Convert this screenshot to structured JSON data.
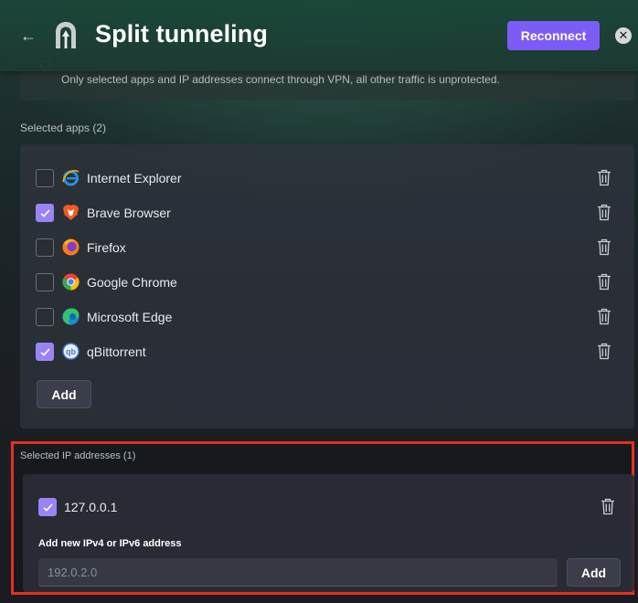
{
  "header": {
    "title": "Split tunneling",
    "reconnect_label": "Reconnect",
    "back_icon": "arrow-left-icon",
    "close_icon": "close-icon"
  },
  "mode": {
    "description": "Only selected apps and IP addresses connect through VPN, all other traffic is unprotected."
  },
  "apps": {
    "label": "Selected apps (2)",
    "items": [
      {
        "name": "Internet Explorer",
        "checked": false,
        "icon": "internet-explorer-icon"
      },
      {
        "name": "Brave Browser",
        "checked": true,
        "icon": "brave-icon"
      },
      {
        "name": "Firefox",
        "checked": false,
        "icon": "firefox-icon"
      },
      {
        "name": "Google Chrome",
        "checked": false,
        "icon": "chrome-icon"
      },
      {
        "name": "Microsoft Edge",
        "checked": false,
        "icon": "edge-icon"
      },
      {
        "name": "qBittorrent",
        "checked": true,
        "icon": "qbittorrent-icon"
      }
    ],
    "add_label": "Add"
  },
  "ips": {
    "label": "Selected IP addresses (1)",
    "items": [
      {
        "address": "127.0.0.1",
        "checked": true
      }
    ],
    "add_new_label": "Add new IPv4 or IPv6 address",
    "input_placeholder": "192.0.2.0",
    "input_value": "",
    "add_label": "Add"
  },
  "colors": {
    "accent": "#7b5cf6",
    "checkbox_checked": "#9a84f5",
    "highlight_border": "#e1311c"
  }
}
